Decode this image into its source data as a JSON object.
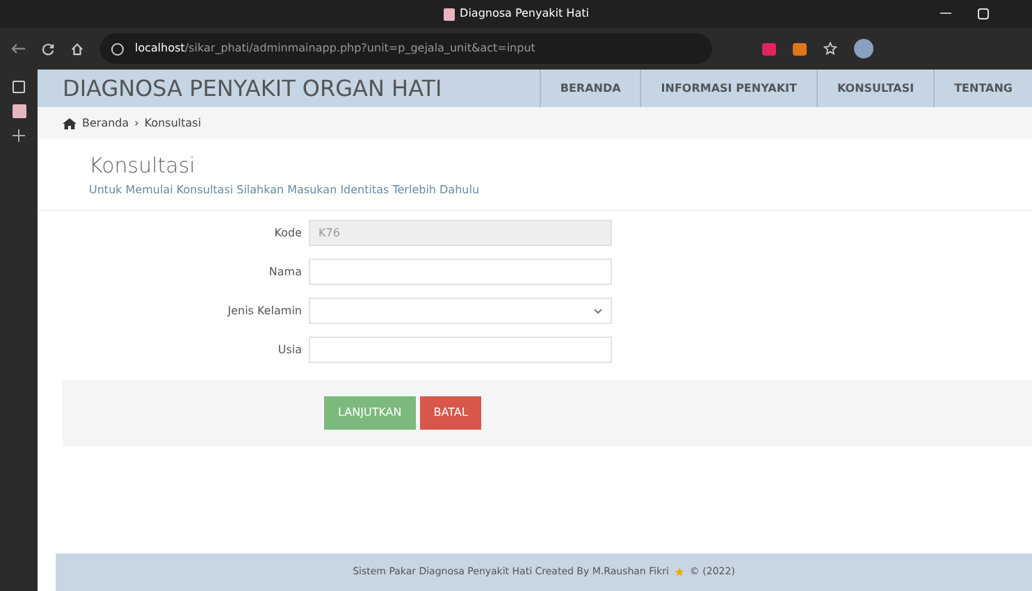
{
  "browser": {
    "tab_title": "Diagnosa Penyakit Hati",
    "url_host": "localhost",
    "url_path": "/sikar_phati/adminmainapp.php?unit=p_gejala_unit&act=input"
  },
  "header": {
    "title": "DIAGNOSA PENYAKIT ORGAN HATI",
    "nav": [
      {
        "label": "BERANDA",
        "selected": false
      },
      {
        "label": "INFORMASI PENYAKIT",
        "selected": false
      },
      {
        "label": "KONSULTASI",
        "selected": false
      },
      {
        "label": "TENTANG",
        "selected": false
      }
    ]
  },
  "breadcrumb": [
    "Beranda",
    "›",
    "Konsultasi"
  ],
  "page": {
    "title": "Konsultasi",
    "subtitle": "Untuk Memulai Konsultasi Silahkan Masukan Identitas Terlebih Dahulu"
  },
  "form": [
    {
      "label": "Kode",
      "kind": "text",
      "value": "K76",
      "disabled": true
    },
    {
      "label": "Nama",
      "kind": "text",
      "disabled": false
    },
    {
      "label": "Jenis Kelamin",
      "kind": "select",
      "disabled": false
    },
    {
      "label": "Usia",
      "kind": "text",
      "disabled": false
    }
  ],
  "buttons": [
    {
      "label": "LANJUTKAN",
      "kind": "primary"
    },
    {
      "label": "BATAL",
      "kind": "danger"
    }
  ],
  "footer": {
    "text": "Sistem Pakar Diagnosa Penyakit Hati Created By M.Raushan Fikri",
    "copyright": "© (2022)"
  }
}
